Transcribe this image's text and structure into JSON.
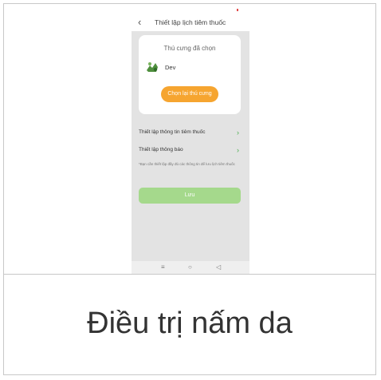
{
  "screen": {
    "back_icon": "chevron-left-icon",
    "title": "Thiết lập lịch tiêm thuốc",
    "pet_card": {
      "title": "Thú cưng đã chọn",
      "pet_icon": "pet-avatar-icon",
      "pet_name": "Dev",
      "choose_button": "Chọn lại thú cưng"
    },
    "settings": [
      {
        "label": "Thiết lập thông tin tiêm thuốc",
        "icon": "chevron-right-icon"
      },
      {
        "label": "Thiết lập thông báo",
        "icon": "chevron-right-icon"
      }
    ],
    "note": "*Bạn cần thiết lập đầy đủ các thông tin để lưu lịch tiêm thuốc",
    "save_button": "Lưu",
    "nav": {
      "menu_icon": "≡",
      "home_icon": "○",
      "back_icon": "◁"
    }
  },
  "caption": "Điều trị nấm da",
  "colors": {
    "accent_orange": "#f6a530",
    "accent_green": "#a5d98c",
    "chevron_green": "#4caf50",
    "phone_bg": "#e3e3e3"
  }
}
